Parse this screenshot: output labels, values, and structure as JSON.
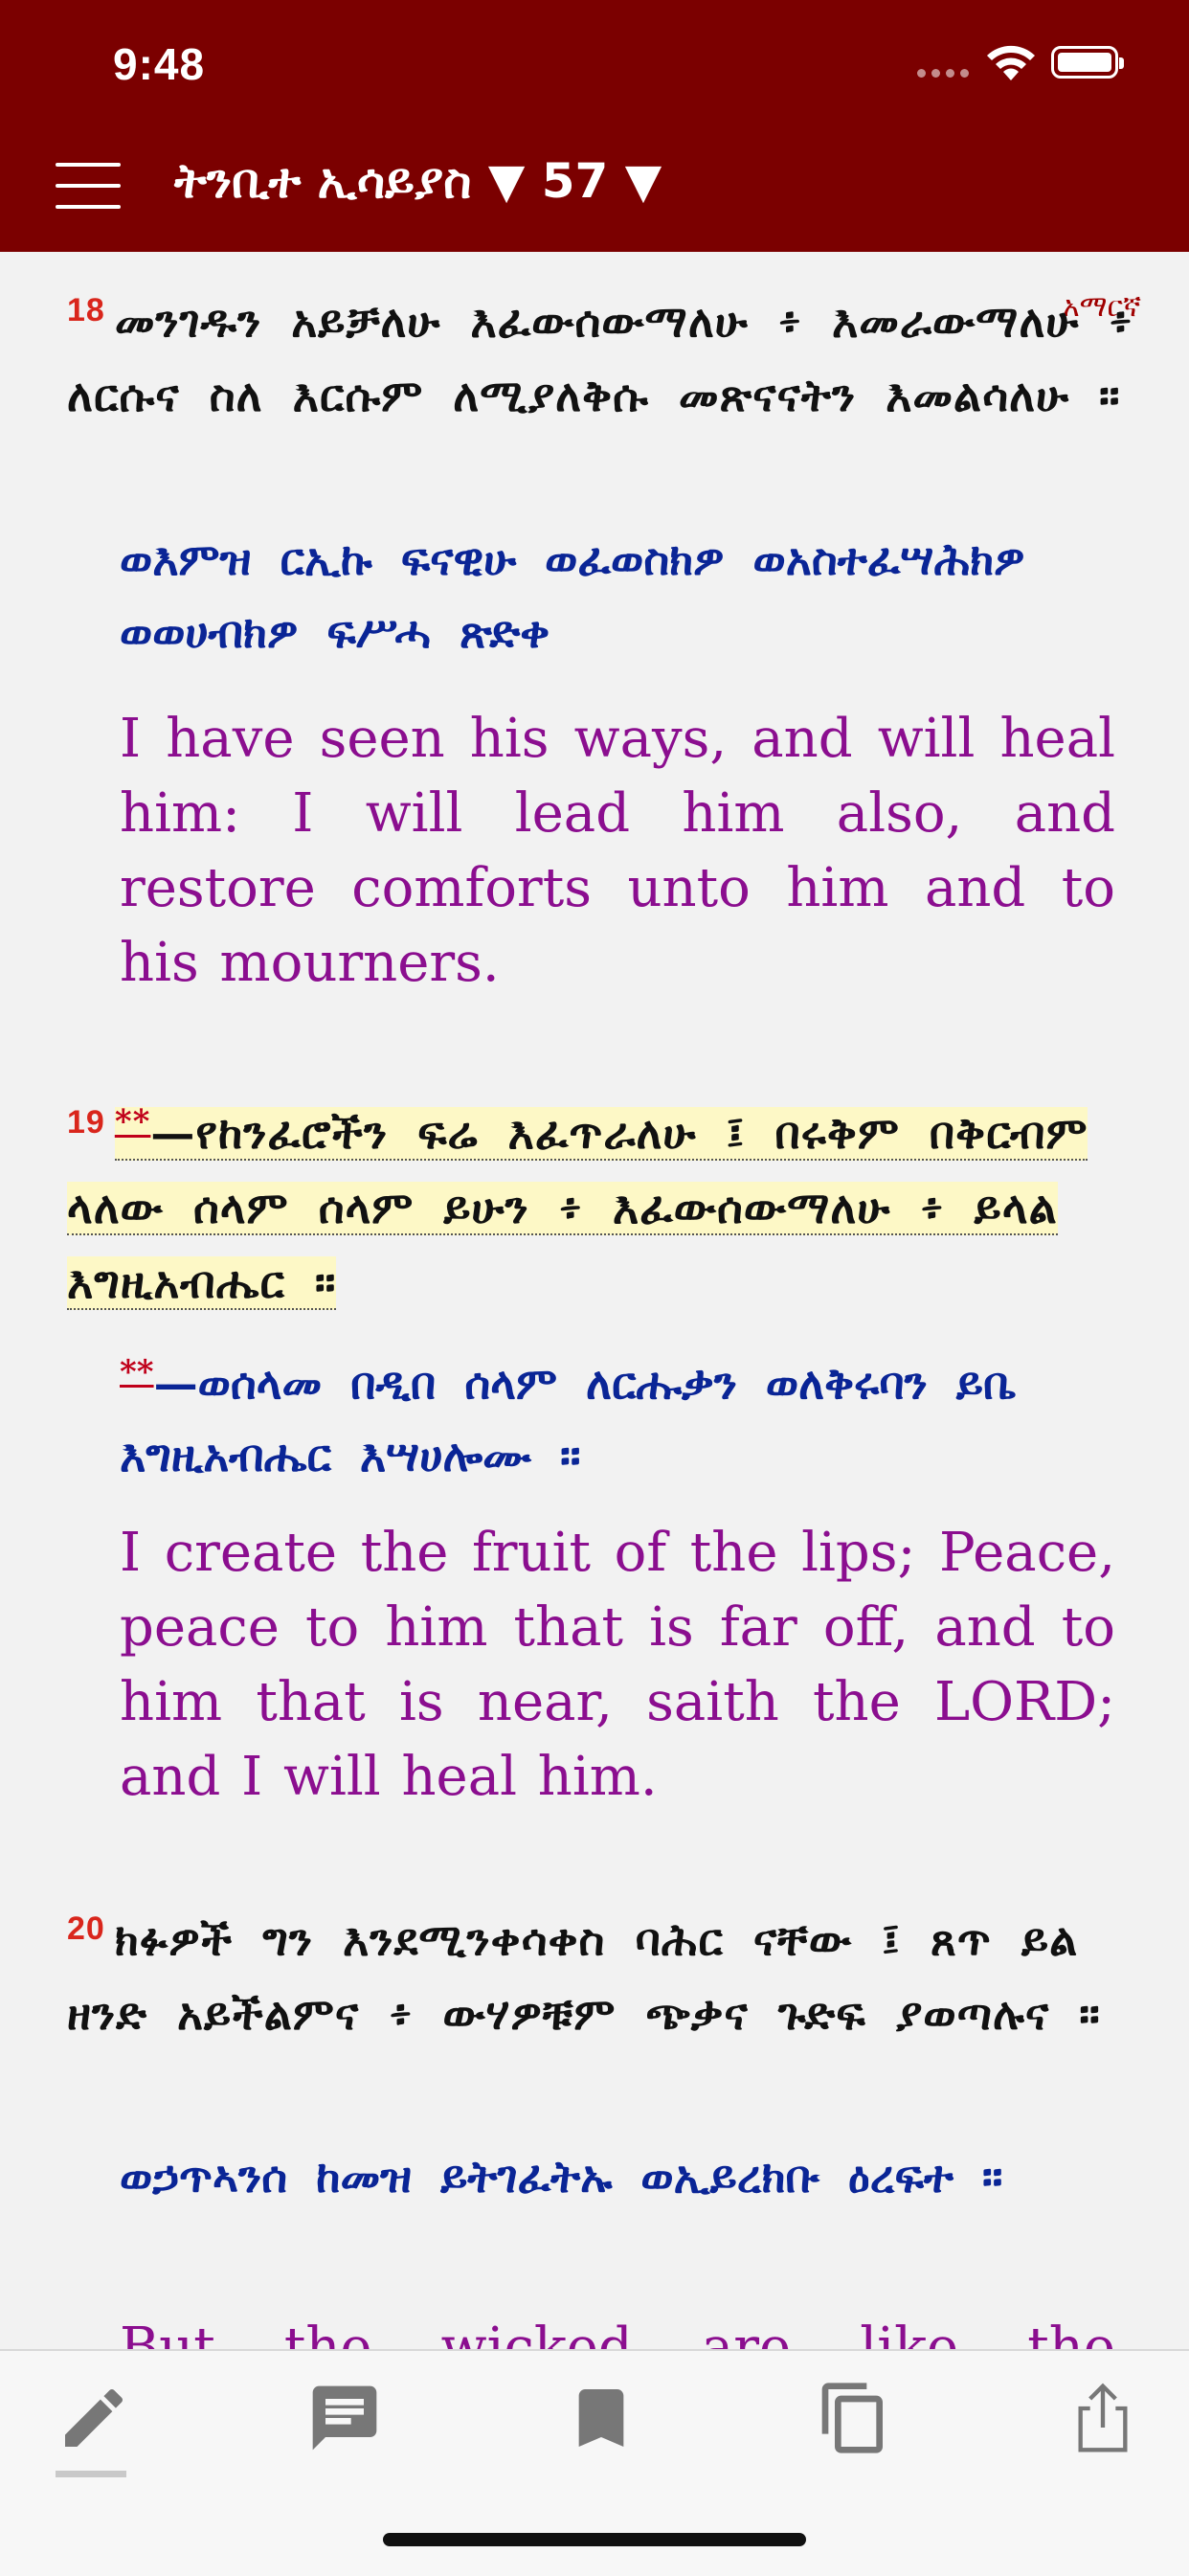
{
  "status_bar": {
    "time": "9:48"
  },
  "header": {
    "title": "ትንቢተ ኢሳይያስ ▼ 57 ▼"
  },
  "language_tag": "አማርኛ",
  "verses": [
    {
      "number": "18",
      "amharic": "መንገዱን አይቻለሁ እፈውሰውማለሁ ፥ እመራውማለሁ ፥ ለርሱና ስለ እርሱም ለሚያለቅሱ መጽናናትን እመልሳለሁ ።",
      "geez": "ወእምዝ ርኢኩ ፍናዊሁ ወፈወስክዎ ወአስተፈሣሕክዎ ወወሀብክዎ ፍሥሓ ጽድቀ",
      "english": "I have seen his ways, and will heal him: I will lead him also, and restore comforts unto him and to his mourners."
    },
    {
      "number": "19",
      "marker": "**",
      "amharic": "—የከንፈሮችን ፍሬ እፈጥራለሁ ፤ በሩቅም በቅርብም ላለው ሰላም ሰላም ይሁን ፥ እፈውሰውማለሁ ፥ ይላል እግዚአብሔር ።",
      "geez_marker": "**",
      "geez": "—ወሰላመ በዲበ ሰላም ለርሑቃን ወለቅሩባን ይቤ እግዚአብሔር እሣሀሎሙ ።",
      "english": "I create the fruit of the lips; Peace, peace to him that is far off, and to him that is near, saith the LORD; and I will heal him."
    },
    {
      "number": "20",
      "amharic": "ክፉዎች ግን እንደሚንቀሳቀስ ባሕር ናቸው ፤ ጸጥ ይል ዘንድ አይችልምና ፥ ውሃዎቹም ጭቃና ጉድፍ ያወጣሉና ።",
      "geez": "ወኃጥኣንሰ ከመዝ ይትገፈትኡ ወኢይረክቡ ዕረፍተ ።",
      "english": "But the wicked are like the troubled"
    }
  ],
  "toolbar": {
    "items": [
      "edit-icon",
      "comment-icon",
      "bookmark-icon",
      "copy-icon",
      "share-icon"
    ]
  },
  "colors": {
    "header_bg": "#7b0000",
    "verse_number": "#d9261c",
    "geez_text": "#0a2596",
    "english_text": "#8b0e8f",
    "highlight": "#fdf8c6"
  }
}
